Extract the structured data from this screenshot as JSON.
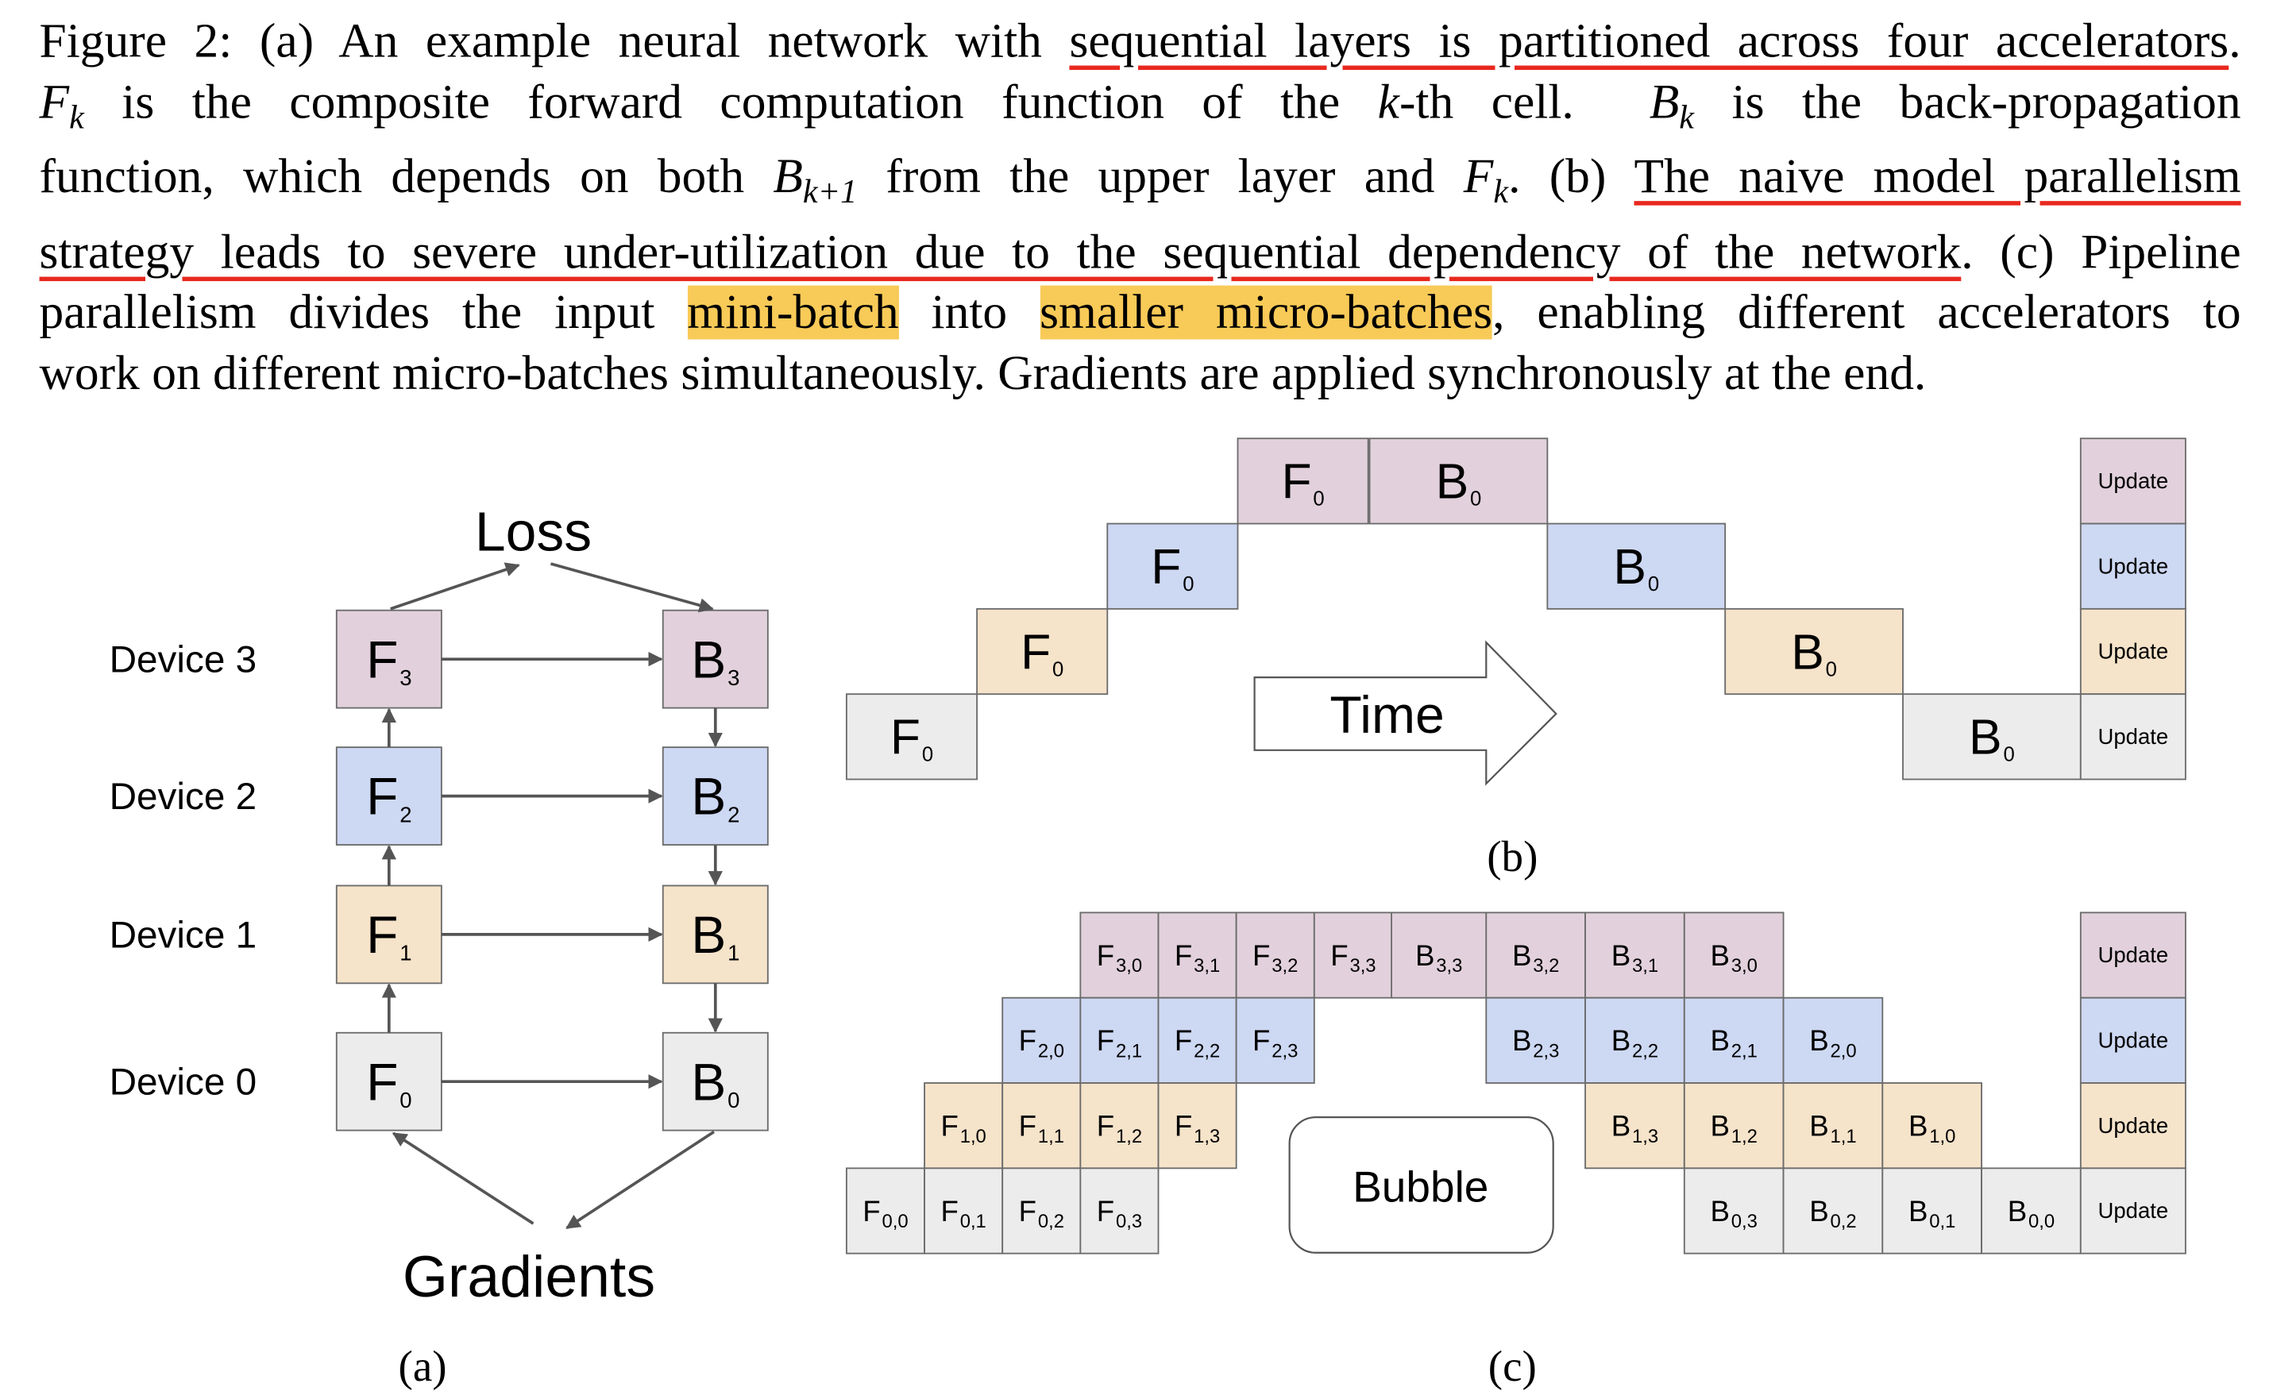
{
  "caption": {
    "lines": [
      [
        {
          "t": "Figure 2: (a) An example neural network with "
        },
        {
          "t": "sequential layers is partitioned across four accelerators",
          "s": "u"
        },
        {
          "t": "."
        }
      ],
      [
        {
          "t": "F",
          "s": "it"
        },
        {
          "t": "k",
          "s": "it sub"
        },
        {
          "t": " is the composite forward computation function of the "
        },
        {
          "t": "k",
          "s": "it"
        },
        {
          "t": "-th cell.  "
        },
        {
          "t": "B",
          "s": "it"
        },
        {
          "t": "k",
          "s": "it sub"
        },
        {
          "t": " is the back-propagation"
        }
      ],
      [
        {
          "t": "function, which depends on both "
        },
        {
          "t": "B",
          "s": "it"
        },
        {
          "t": "k+1",
          "s": "it sub"
        },
        {
          "t": " from the upper layer and "
        },
        {
          "t": "F",
          "s": "it"
        },
        {
          "t": "k",
          "s": "it sub"
        },
        {
          "t": ". (b) "
        },
        {
          "t": "The naive model parallelism",
          "s": "u"
        }
      ],
      [
        {
          "t": "strategy leads to severe under-utilization due to the sequential dependency of the network",
          "s": "u"
        },
        {
          "t": ". (c) Pipeline"
        }
      ],
      [
        {
          "t": "parallelism divides the input "
        },
        {
          "t": "mini-batch",
          "s": "hl"
        },
        {
          "t": " into "
        },
        {
          "t": "smaller micro-batches",
          "s": "hl"
        },
        {
          "t": ", enabling different accelerators to"
        }
      ],
      [
        {
          "t": "work on different micro-batches simultaneously. Gradients are applied synchronously at the end."
        }
      ]
    ]
  },
  "colors": {
    "device3": "#e2d1dc",
    "device2": "#cdd8f3",
    "device1": "#f5e3ca",
    "device0": "#ececec",
    "border": "#6b6b6b",
    "arrow": "#555555",
    "underline": "#e8281e",
    "highlight": "#f8ca57"
  },
  "panel_a": {
    "caption": "(a)",
    "loss_label": "Loss",
    "gradients_label": "Gradients",
    "devices": [
      {
        "label": "Device 3",
        "f": {
          "main": "F",
          "sub": "3"
        },
        "b": {
          "main": "B",
          "sub": "3"
        }
      },
      {
        "label": "Device 2",
        "f": {
          "main": "F",
          "sub": "2"
        },
        "b": {
          "main": "B",
          "sub": "2"
        }
      },
      {
        "label": "Device 1",
        "f": {
          "main": "F",
          "sub": "1"
        },
        "b": {
          "main": "B",
          "sub": "1"
        }
      },
      {
        "label": "Device 0",
        "f": {
          "main": "F",
          "sub": "0"
        },
        "b": {
          "main": "B",
          "sub": "0"
        }
      }
    ]
  },
  "panel_b": {
    "caption": "(b)",
    "time_label": "Time",
    "rows": [
      {
        "f": {
          "main": "F",
          "sub": "0"
        },
        "b": {
          "main": "B",
          "sub": "0"
        },
        "update": "Update"
      },
      {
        "f": {
          "main": "F",
          "sub": "0"
        },
        "b": {
          "main": "B",
          "sub": "0"
        },
        "update": "Update"
      },
      {
        "f": {
          "main": "F",
          "sub": "0"
        },
        "b": {
          "main": "B",
          "sub": "0"
        },
        "update": "Update"
      },
      {
        "f": {
          "main": "F",
          "sub": "0"
        },
        "b": {
          "main": "B",
          "sub": "0"
        },
        "update": "Update"
      }
    ]
  },
  "panel_c": {
    "caption": "(c)",
    "bubble_label": "Bubble",
    "rows": [
      {
        "f": [
          {
            "main": "F",
            "sub": "3,0"
          },
          {
            "main": "F",
            "sub": "3,1"
          },
          {
            "main": "F",
            "sub": "3,2"
          },
          {
            "main": "F",
            "sub": "3,3"
          }
        ],
        "b": [
          {
            "main": "B",
            "sub": "3,3"
          },
          {
            "main": "B",
            "sub": "3,2"
          },
          {
            "main": "B",
            "sub": "3,1"
          },
          {
            "main": "B",
            "sub": "3,0"
          }
        ],
        "update": "Update"
      },
      {
        "f": [
          {
            "main": "F",
            "sub": "2,0"
          },
          {
            "main": "F",
            "sub": "2,1"
          },
          {
            "main": "F",
            "sub": "2,2"
          },
          {
            "main": "F",
            "sub": "2,3"
          }
        ],
        "b": [
          {
            "main": "B",
            "sub": "2,3"
          },
          {
            "main": "B",
            "sub": "2,2"
          },
          {
            "main": "B",
            "sub": "2,1"
          },
          {
            "main": "B",
            "sub": "2,0"
          }
        ],
        "update": "Update"
      },
      {
        "f": [
          {
            "main": "F",
            "sub": "1,0"
          },
          {
            "main": "F",
            "sub": "1,1"
          },
          {
            "main": "F",
            "sub": "1,2"
          },
          {
            "main": "F",
            "sub": "1,3"
          }
        ],
        "b": [
          {
            "main": "B",
            "sub": "1,3"
          },
          {
            "main": "B",
            "sub": "1,2"
          },
          {
            "main": "B",
            "sub": "1,1"
          },
          {
            "main": "B",
            "sub": "1,0"
          }
        ],
        "update": "Update"
      },
      {
        "f": [
          {
            "main": "F",
            "sub": "0,0"
          },
          {
            "main": "F",
            "sub": "0,1"
          },
          {
            "main": "F",
            "sub": "0,2"
          },
          {
            "main": "F",
            "sub": "0,3"
          }
        ],
        "b": [
          {
            "main": "B",
            "sub": "0,3"
          },
          {
            "main": "B",
            "sub": "0,2"
          },
          {
            "main": "B",
            "sub": "0,1"
          },
          {
            "main": "B",
            "sub": "0,0"
          }
        ],
        "update": "Update"
      }
    ]
  }
}
